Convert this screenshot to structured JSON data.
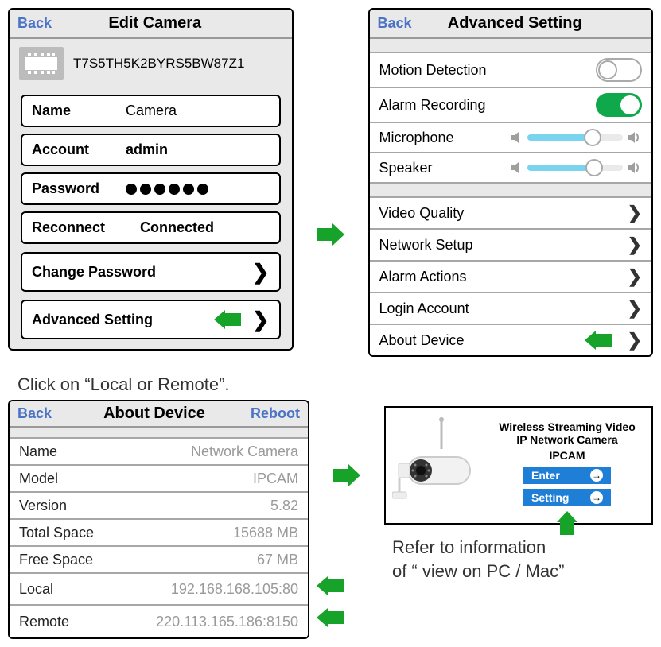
{
  "editCamera": {
    "back": "Back",
    "title": "Edit Camera",
    "deviceId": "T7S5TH5K2BYRS5BW87Z1",
    "name": {
      "label": "Name",
      "value": "Camera"
    },
    "account": {
      "label": "Account",
      "value": "admin"
    },
    "password": {
      "label": "Password"
    },
    "reconnect": {
      "label": "Reconnect",
      "value": "Connected"
    },
    "changePassword": "Change Password",
    "advancedSetting": "Advanced Setting"
  },
  "advanced": {
    "back": "Back",
    "title": "Advanced Setting",
    "motion": "Motion Detection",
    "alarmRec": "Alarm Recording",
    "mic": "Microphone",
    "speaker": "Speaker",
    "videoQuality": "Video Quality",
    "networkSetup": "Network Setup",
    "alarmActions": "Alarm Actions",
    "loginAccount": "Login Account",
    "aboutDevice": "About Device"
  },
  "instruction1": "Click on “Local or Remote”.",
  "aboutDevice": {
    "back": "Back",
    "title": "About Device",
    "reboot": "Reboot",
    "rows": {
      "name": {
        "label": "Name",
        "value": "Network Camera"
      },
      "model": {
        "label": "Model",
        "value": "IPCAM"
      },
      "version": {
        "label": "Version",
        "value": "5.82"
      },
      "totalSpace": {
        "label": "Total Space",
        "value": "15688 MB"
      },
      "freeSpace": {
        "label": "Free Space",
        "value": "67 MB"
      },
      "local": {
        "label": "Local",
        "value": "192.168.168.105:80"
      },
      "remote": {
        "label": "Remote",
        "value": "220.113.165.186:8150"
      }
    }
  },
  "webUI": {
    "line1": "Wireless Streaming Video",
    "line2": "IP Network Camera",
    "line3": "IPCAM",
    "enter": "Enter",
    "setting": "Setting"
  },
  "referText1": "Refer to information",
  "referText2": "of “ view on PC / Mac”"
}
